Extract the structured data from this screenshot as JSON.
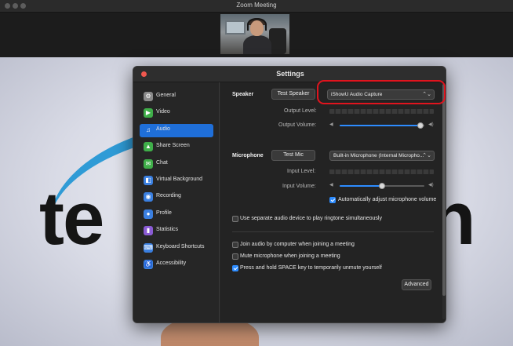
{
  "window": {
    "title": "Zoom Meeting"
  },
  "dialog": {
    "title": "Settings"
  },
  "sidebar": {
    "items": [
      {
        "label": "General",
        "icon": "gear-icon",
        "color": "#8a8a8a",
        "glyph": "⚙",
        "active": false
      },
      {
        "label": "Video",
        "icon": "video-icon",
        "color": "#3fae49",
        "glyph": "▶",
        "active": false
      },
      {
        "label": "Audio",
        "icon": "headphones-icon",
        "color": "#1f6fd9",
        "glyph": "♫",
        "active": true
      },
      {
        "label": "Share Screen",
        "icon": "share-screen-icon",
        "color": "#3fae49",
        "glyph": "▲",
        "active": false
      },
      {
        "label": "Chat",
        "icon": "chat-icon",
        "color": "#3fae49",
        "glyph": "✉",
        "active": false
      },
      {
        "label": "Virtual Background",
        "icon": "virtual-background-icon",
        "color": "#3a7fe0",
        "glyph": "◧",
        "active": false
      },
      {
        "label": "Recording",
        "icon": "recording-icon",
        "color": "#3a7fe0",
        "glyph": "◉",
        "active": false
      },
      {
        "label": "Profile",
        "icon": "profile-icon",
        "color": "#3a7fe0",
        "glyph": "●",
        "active": false
      },
      {
        "label": "Statistics",
        "icon": "statistics-icon",
        "color": "#8a5bd4",
        "glyph": "▮",
        "active": false
      },
      {
        "label": "Keyboard Shortcuts",
        "icon": "keyboard-icon",
        "color": "#3a7fe0",
        "glyph": "⌨",
        "active": false
      },
      {
        "label": "Accessibility",
        "icon": "accessibility-icon",
        "color": "#3a7fe0",
        "glyph": "♿",
        "active": false
      }
    ]
  },
  "speaker": {
    "section_label": "Speaker",
    "test_button": "Test Speaker",
    "device": "iShowU Audio Capture",
    "output_level_label": "Output Level:",
    "output_volume_label": "Output Volume:",
    "output_volume_level": 0.95
  },
  "microphone": {
    "section_label": "Microphone",
    "test_button": "Test Mic",
    "device": "Built-in Microphone (Internal Micropho...",
    "input_level_label": "Input Level:",
    "input_volume_label": "Input Volume:",
    "input_volume_level": 0.5,
    "auto_adjust_label": "Automatically adjust microphone volume",
    "auto_adjust_checked": true
  },
  "options": {
    "separate_device_label": "Use separate audio device to play ringtone simultaneously",
    "separate_device_checked": false,
    "join_by_computer_label": "Join audio by computer when joining a meeting",
    "join_by_computer_checked": false,
    "mute_on_join_label": "Mute microphone when joining a meeting",
    "mute_on_join_checked": false,
    "space_to_unmute_label": "Press and hold SPACE key to temporarily unmute yourself",
    "space_to_unmute_checked": true
  },
  "advanced_button": "Advanced",
  "background": {
    "logo_left": "te",
    "logo_right": "n"
  },
  "colors": {
    "accent": "#1f6fd9",
    "slider": "#2d8cff",
    "highlight": "#e0141e",
    "close": "#f0584f"
  }
}
